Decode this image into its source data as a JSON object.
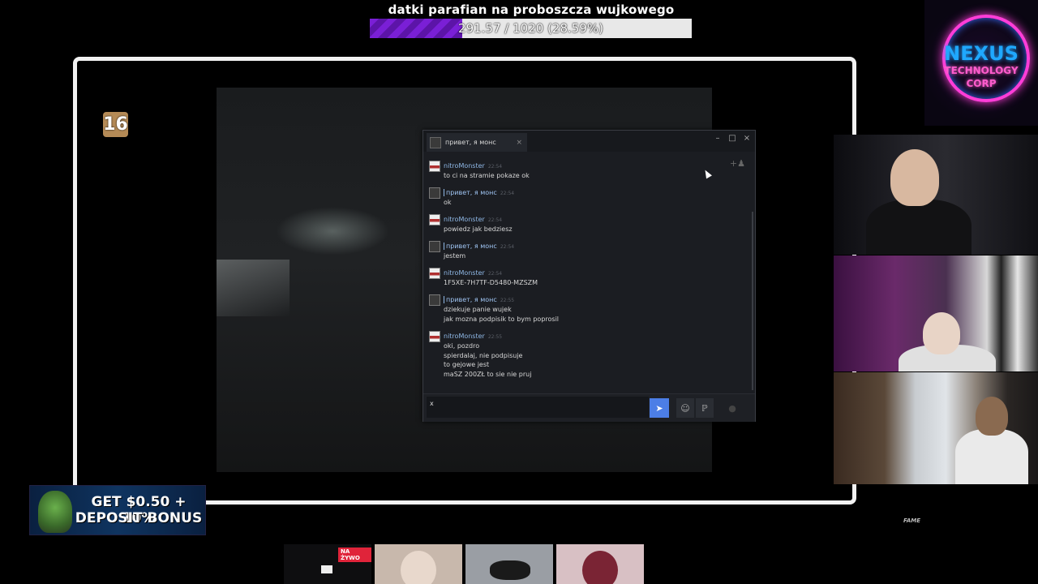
{
  "goal": {
    "title": "datki parafian na proboszcza wujkowego",
    "progress_text": "291.57 / 1020 (28.59%)",
    "fraction": 0.2859
  },
  "logo": {
    "name": "NEXUS",
    "sub1": "TECHNOLOGY",
    "sub2": "CORP"
  },
  "video": {
    "age_rating": "16"
  },
  "chat": {
    "tab_title": "привет, я монс",
    "tab_close": "×",
    "controls": {
      "minimize": "–",
      "maximize": "□",
      "close": "×"
    },
    "messages": [
      {
        "author": "nitroMonster",
        "author_type": "nitro",
        "time": "22:54",
        "lines": [
          "to ci na stramie pokaze ok"
        ]
      },
      {
        "author": "привет, я монс",
        "author_type": "mons",
        "time": "22:54",
        "lines": [
          "ok"
        ]
      },
      {
        "author": "nitroMonster",
        "author_type": "nitro",
        "time": "22:54",
        "lines": [
          "powiedz jak bedziesz"
        ]
      },
      {
        "author": "привет, я монс",
        "author_type": "mons",
        "time": "22:54",
        "lines": [
          "jestem"
        ]
      },
      {
        "author": "nitroMonster",
        "author_type": "nitro",
        "time": "22:54",
        "lines": [
          "1F5XE-7H7TF-D5480-MZSZM"
        ]
      },
      {
        "author": "привет, я монс",
        "author_type": "mons",
        "time": "22:55",
        "lines": [
          "dziekuje panie wujek",
          "jak mozna podpisik to bym poprosil"
        ]
      },
      {
        "author": "nitroMonster",
        "author_type": "nitro",
        "time": "22:55",
        "lines": [
          "oki, pozdro",
          "spierdalaj, nie podpisuje",
          "to gejowe jest",
          "maSZ 200ZŁ to sie nie pruj"
        ]
      }
    ],
    "input_value": "x",
    "send_icon": "send-icon",
    "emoji_icon": "emoji-icon",
    "attach_icon": "paperclip-icon"
  },
  "ad": {
    "line1": "GET $0.50 + 10%",
    "line2": "DEPOSIT BONUS"
  },
  "watermark": "FAME",
  "tiles": {
    "live_badge": "NA ŻYWO"
  }
}
